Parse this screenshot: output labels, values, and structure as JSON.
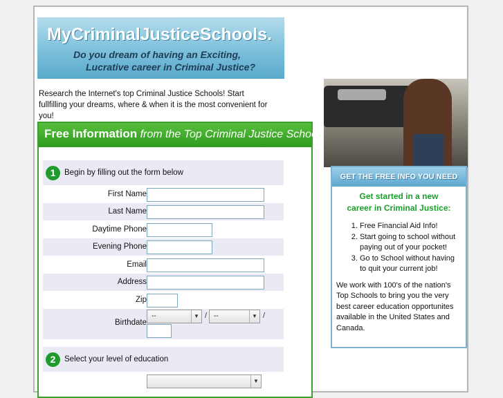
{
  "banner": {
    "title": "MyCriminalJusticeSchools.",
    "tagline_line1": "Do you dream of having an Exciting,",
    "tagline_line2": "Lucrative career in Criminal Justice?"
  },
  "intro": "Research the Internet's top Criminal Justice Schools! Start fullfilling your dreams, where & when it is the most convenient for you!",
  "form": {
    "header_strong": "Free Information",
    "header_em": " from the Top Criminal Justice Schools",
    "step1": {
      "number": "1",
      "label": "Begin by filling out the form below"
    },
    "fields": [
      {
        "label": "First Name"
      },
      {
        "label": "Last Name"
      },
      {
        "label": "Daytime Phone"
      },
      {
        "label": "Evening Phone"
      },
      {
        "label": "Email"
      },
      {
        "label": "Address"
      },
      {
        "label": "Zip"
      },
      {
        "label": "Birthdate"
      }
    ],
    "birthdate": {
      "month": "--",
      "day": "--",
      "sep": "/"
    },
    "step2": {
      "number": "2",
      "label": "Select your level of education"
    }
  },
  "sidebar": {
    "header": "GET THE FREE INFO YOU NEED",
    "title_line1": "Get started in a new",
    "title_line2": "career in Criminal Justice:",
    "items": [
      "Free Financial Aid Info!",
      "Start going to school without paying out of your pocket!",
      "Go to School without having to quit your current job!"
    ],
    "paragraph": "We work with 100's of the nation's Top Schools to bring you the very best career education opportunites available in the United States and Canada."
  }
}
